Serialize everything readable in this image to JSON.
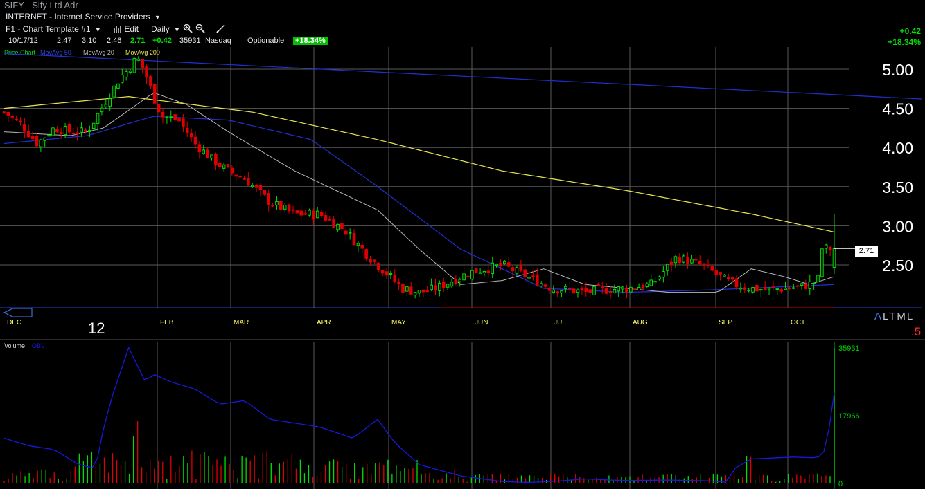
{
  "header": {
    "symbol_line": "SIFY - Sify Ltd Adr",
    "industry": "INTERNET - Internet Service Providers",
    "industry_arrow": "▼",
    "template": "F1 - Chart Template #1",
    "template_arrow": "▼",
    "edit": "Edit",
    "period": "Daily",
    "period_arrow": "▼",
    "date": "10/17/12",
    "open": "2.47",
    "high": "3.10",
    "low": "2.46",
    "close": "2.71",
    "change": "+0.42",
    "volume": "35931",
    "exchange": "Nasdaq",
    "optionable": "Optionable",
    "pct_badge": "+18.34%",
    "right_change": "+0.42",
    "right_pct": "+18.34%"
  },
  "legend": {
    "price_chart": "Price Chart",
    "ma50": "MovAvg 50",
    "ma20": "MovAvg 20",
    "ma200": "MovAvg 200",
    "volume": "Volume",
    "obv": "OBV"
  },
  "markers": {
    "last_price": "2.71",
    "altml_a": "A",
    "altml_rest": "LTML",
    "five": ".5",
    "year": "12"
  },
  "colors": {
    "up": "#00e000",
    "down": "#e00000",
    "ma50": "#2030d0",
    "ma20": "#b8b8b8",
    "ma200": "#e8e850",
    "obv": "#1818e0",
    "grid": "#5a5a5a",
    "month_label": "#ffff66"
  },
  "chart_data": [
    {
      "type": "candlestick",
      "title": "",
      "x_months": [
        "DEC",
        "FEB",
        "MAR",
        "APR",
        "MAY",
        "JUN",
        "JUL",
        "AUG",
        "SEP",
        "OCT"
      ],
      "y_ticks": [
        "5.00",
        "4.50",
        "4.00",
        "3.50",
        "3.00",
        "2.50"
      ],
      "ylim": [
        2.1,
        5.3
      ],
      "grid": true,
      "close_series": {
        "t": [
          0,
          0.02,
          0.04,
          0.06,
          0.08,
          0.1,
          0.12,
          0.14,
          0.15,
          0.16,
          0.17,
          0.18,
          0.19,
          0.21,
          0.23,
          0.25,
          0.27,
          0.29,
          0.32,
          0.35,
          0.38,
          0.41,
          0.44,
          0.46,
          0.48,
          0.5,
          0.52,
          0.56,
          0.6,
          0.64,
          0.66,
          0.68,
          0.7,
          0.72,
          0.75,
          0.78,
          0.81,
          0.84,
          0.87,
          0.88,
          0.9,
          0.92,
          0.94,
          0.96,
          0.98,
          0.985,
          1
        ],
        "close": [
          4.45,
          4.3,
          4.05,
          4.25,
          4.2,
          4.2,
          4.55,
          4.9,
          5.0,
          5.15,
          4.95,
          4.65,
          4.4,
          4.35,
          4.05,
          3.85,
          3.7,
          3.6,
          3.3,
          3.15,
          3.15,
          2.95,
          2.6,
          2.4,
          2.2,
          2.15,
          2.2,
          2.4,
          2.5,
          2.3,
          2.2,
          2.18,
          2.15,
          2.18,
          2.2,
          2.25,
          2.6,
          2.5,
          2.3,
          2.25,
          2.2,
          2.18,
          2.2,
          2.22,
          2.29,
          2.71,
          2.71
        ]
      },
      "ma200": {
        "t": [
          0,
          0.15,
          0.3,
          0.45,
          0.6,
          0.75,
          0.9,
          1
        ],
        "values": [
          4.5,
          4.65,
          4.45,
          4.1,
          3.7,
          3.45,
          3.15,
          2.92
        ]
      },
      "ma50": {
        "t": [
          0,
          0.1,
          0.18,
          0.27,
          0.37,
          0.45,
          0.55,
          0.65,
          0.75,
          0.85,
          1
        ],
        "values": [
          4.05,
          4.15,
          4.4,
          4.35,
          4.1,
          3.5,
          2.7,
          2.2,
          2.15,
          2.18,
          2.25
        ]
      },
      "ma20": {
        "t": [
          0,
          0.08,
          0.12,
          0.18,
          0.22,
          0.27,
          0.35,
          0.45,
          0.5,
          0.55,
          0.6,
          0.65,
          0.7,
          0.75,
          0.8,
          0.86,
          0.9,
          0.94,
          0.97,
          1
        ],
        "values": [
          4.2,
          4.15,
          4.25,
          4.7,
          4.55,
          4.2,
          3.7,
          3.2,
          2.7,
          2.25,
          2.3,
          2.45,
          2.25,
          2.2,
          2.15,
          2.15,
          2.45,
          2.35,
          2.25,
          2.35
        ]
      },
      "long_line": {
        "t": [
          0,
          1
        ],
        "values": [
          5.2,
          4.65
        ]
      },
      "last": 2.71
    },
    {
      "type": "line",
      "title": "",
      "series_names": [
        "OBV"
      ],
      "y_ticks": [
        "35931",
        "17966",
        "0"
      ],
      "ylim": [
        0,
        35931
      ],
      "obv": {
        "t": [
          0,
          0.03,
          0.06,
          0.09,
          0.11,
          0.12,
          0.13,
          0.15,
          0.17,
          0.18,
          0.2,
          0.23,
          0.26,
          0.29,
          0.32,
          0.35,
          0.38,
          0.42,
          0.45,
          0.47,
          0.5,
          0.55,
          0.6,
          0.63,
          0.66,
          0.7,
          0.73,
          0.75,
          0.8,
          0.85,
          0.87,
          0.88,
          0.9,
          0.95,
          0.98,
          0.99,
          1
        ],
        "values": [
          12000,
          10000,
          9000,
          5000,
          4000,
          15000,
          23000,
          36000,
          27000,
          29000,
          27000,
          25000,
          21000,
          22000,
          17000,
          16000,
          15000,
          12000,
          17000,
          11000,
          5000,
          2000,
          500,
          300,
          500,
          1200,
          900,
          800,
          900,
          700,
          300,
          4000,
          6500,
          7000,
          6800,
          9000,
          24000
        ]
      },
      "volume_bars": {
        "n": 200,
        "description_hint": "dense red/green daily volume bars at bottom",
        "peak_t": 0.15
      }
    }
  ]
}
